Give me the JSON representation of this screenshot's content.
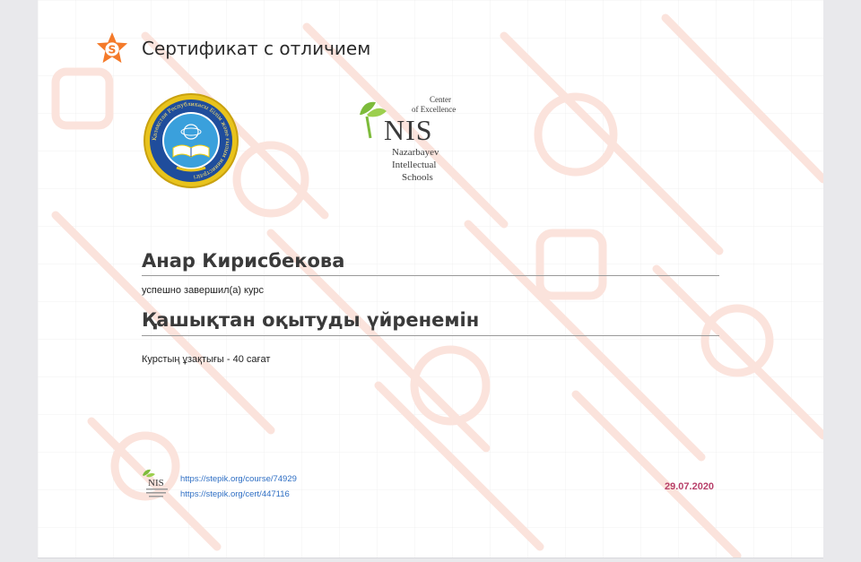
{
  "header": {
    "title": "Сертификат с отличием",
    "logo_icon": "stepik-badge-icon"
  },
  "emblem": {
    "ring_text": "Қазақстан Республикасы Білім және ғылым министрлігі",
    "icon": "ministry-emblem-icon"
  },
  "nis_logo": {
    "line1": "Center",
    "line2": "of Excellence",
    "mark": "NIS",
    "line3": "Nazarbayev",
    "line4": "Intellectual",
    "line5": "Schools"
  },
  "certificate": {
    "recipient": "Анар Кирисбекова",
    "completed_text": "успешно завершил(а) курс",
    "course_title": "Қашықтан оқытуды үйренемін",
    "duration": "Курстың ұзақтығы - 40 сағат",
    "date": "29.07.2020"
  },
  "footer": {
    "course_link": "https://stepik.org/course/74929",
    "cert_link": "https://stepik.org/cert/447116"
  },
  "colors": {
    "accent_orange": "#f47a2a",
    "date_color": "#b8406a",
    "link_color": "#2f6fc4",
    "nis_green": "#7dbb3b"
  }
}
